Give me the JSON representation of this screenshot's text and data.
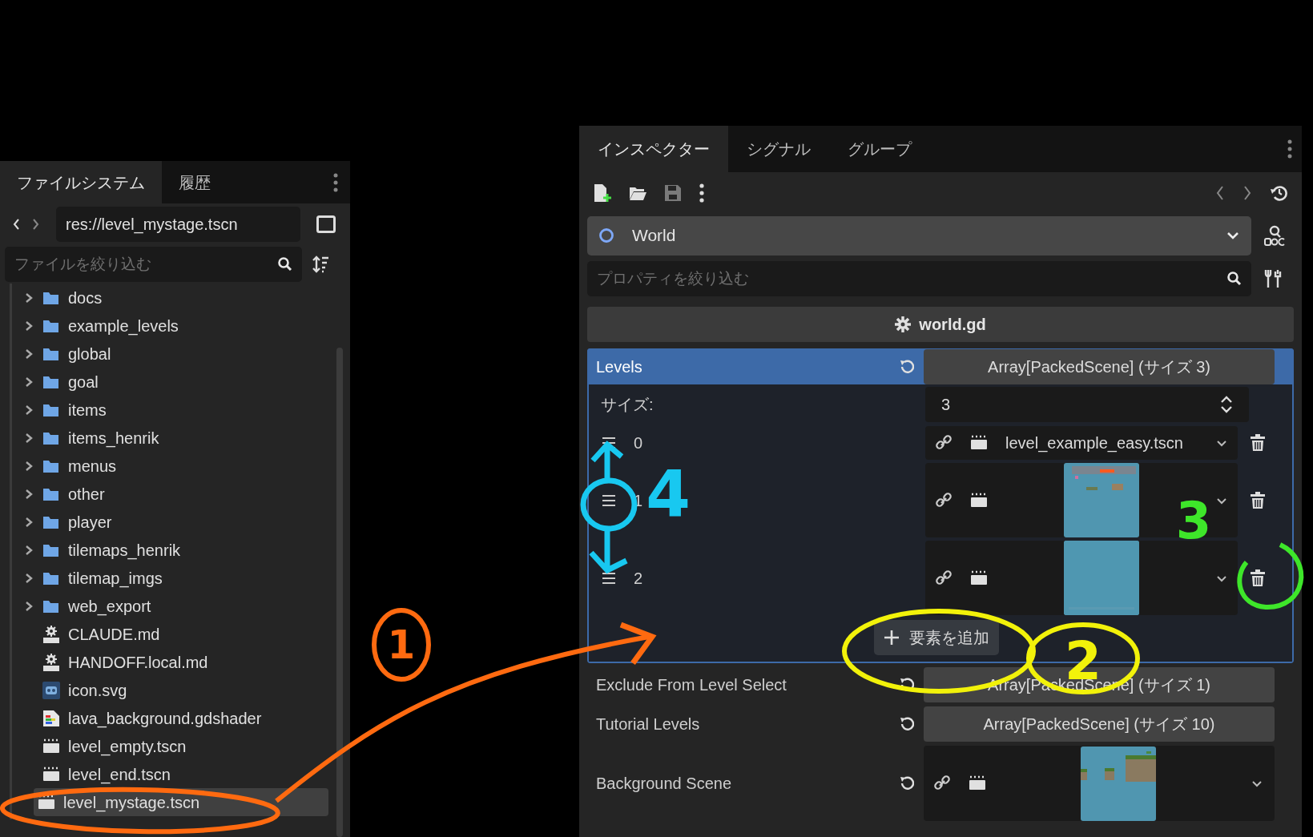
{
  "filesystem": {
    "tabs": [
      {
        "label": "ファイルシステム",
        "selected": true
      },
      {
        "label": "履歴",
        "selected": false
      }
    ],
    "path": "res://level_mystage.tscn",
    "filter_placeholder": "ファイルを絞り込む",
    "tree": [
      {
        "name": "docs",
        "kind": "folder",
        "selected": false
      },
      {
        "name": "example_levels",
        "kind": "folder",
        "selected": false
      },
      {
        "name": "global",
        "kind": "folder",
        "selected": false
      },
      {
        "name": "goal",
        "kind": "folder",
        "selected": false
      },
      {
        "name": "items",
        "kind": "folder",
        "selected": false
      },
      {
        "name": "items_henrik",
        "kind": "folder",
        "selected": false
      },
      {
        "name": "menus",
        "kind": "folder",
        "selected": false
      },
      {
        "name": "other",
        "kind": "folder",
        "selected": false
      },
      {
        "name": "player",
        "kind": "folder",
        "selected": false
      },
      {
        "name": "tilemaps_henrik",
        "kind": "folder",
        "selected": false
      },
      {
        "name": "tilemap_imgs",
        "kind": "folder",
        "selected": false
      },
      {
        "name": "web_export",
        "kind": "folder",
        "selected": false
      },
      {
        "name": "CLAUDE.md",
        "kind": "text",
        "selected": false
      },
      {
        "name": "HANDOFF.local.md",
        "kind": "text",
        "selected": false
      },
      {
        "name": "icon.svg",
        "selected": false
      },
      {
        "name": "lava_background.gdshader",
        "kind": "shader",
        "selected": false
      },
      {
        "name": "level_empty.tscn",
        "kind": "scene",
        "selected": false
      },
      {
        "name": "level_end.tscn",
        "kind": "scene",
        "selected": false
      },
      {
        "name": "level_mystage.tscn",
        "kind": "scene",
        "selected": true
      }
    ]
  },
  "inspector": {
    "tabs": [
      {
        "label": "インスペクター",
        "selected": true
      },
      {
        "label": "シグナル",
        "selected": false
      },
      {
        "label": "グループ",
        "selected": false
      }
    ],
    "node": "World",
    "filter_placeholder": "プロパティを絞り込む",
    "script": "world.gd",
    "properties": [
      {
        "name": "Levels",
        "kind": "array",
        "value": "Array[PackedScene] (サイズ 3)",
        "expanded": true,
        "size_label": "サイズ:",
        "size": "3",
        "add_button": "要素を追加",
        "elements": [
          {
            "index": "0",
            "kind": "file",
            "value": "level_example_easy.tscn"
          },
          {
            "index": "1",
            "kind": "preview"
          },
          {
            "index": "2",
            "kind": "preview"
          }
        ]
      },
      {
        "name": "Exclude From Level Select",
        "kind": "array",
        "value": "Array[PackedScene] (サイズ 1)",
        "expanded": false
      },
      {
        "name": "Tutorial Levels",
        "kind": "array",
        "value": "Array[PackedScene] (サイズ 10)",
        "expanded": false
      },
      {
        "name": "Background Scene",
        "kind": "preview"
      }
    ]
  },
  "annotations": [
    {
      "label": "1",
      "color": "#ff6a10"
    },
    {
      "label": "2",
      "color": "#f2f20a"
    },
    {
      "label": "3",
      "color": "#3ee62a"
    },
    {
      "label": "4",
      "color": "#18c8f0"
    }
  ]
}
